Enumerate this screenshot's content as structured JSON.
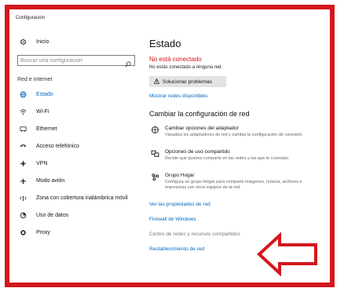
{
  "window": {
    "title": "Configuración"
  },
  "sidebar": {
    "home_label": "Inicio",
    "search_placeholder": "Buscar una configuración",
    "section_label": "Red e Internet",
    "items": [
      {
        "label": "Estado",
        "icon": "globe-icon"
      },
      {
        "label": "Wi-Fi",
        "icon": "wifi-icon"
      },
      {
        "label": "Ethernet",
        "icon": "ethernet-icon"
      },
      {
        "label": "Acceso telefónico",
        "icon": "dialup-icon"
      },
      {
        "label": "VPN",
        "icon": "vpn-icon"
      },
      {
        "label": "Modo avión",
        "icon": "airplane-icon"
      },
      {
        "label": "Zona con cobertura inalámbrica móvil",
        "icon": "hotspot-icon"
      },
      {
        "label": "Uso de datos",
        "icon": "data-usage-icon"
      },
      {
        "label": "Proxy",
        "icon": "proxy-icon"
      }
    ]
  },
  "main": {
    "title": "Estado",
    "status": "No está conectado",
    "status_detail": "No estás conectado a ninguna red.",
    "troubleshoot_button": "Solucionar problemas",
    "show_networks_link": "Mostrar redes disponibles",
    "change_heading": "Cambiar la configuración de red",
    "options": [
      {
        "title": "Cambiar opciones del adaptador",
        "desc": "Visualiza los adaptadores de red y cambia la configuración de conexión."
      },
      {
        "title": "Opciones de uso compartido",
        "desc": "Decide qué quieres compartir en las redes a las que te conectas."
      },
      {
        "title": "Grupo Hogar",
        "desc": "Configura un grupo Hogar para compartir imágenes, música, archivos e impresoras con otros equipos de la red."
      }
    ],
    "links": {
      "properties": "Ver las propiedades de red",
      "firewall": "Firewall de Windows",
      "network_center": "Centro de redes y recursos compartidos",
      "reset": "Restablecimiento de red"
    }
  },
  "colors": {
    "frame": "#d3171d",
    "accent": "#0067c0",
    "status": "#d3171d"
  }
}
